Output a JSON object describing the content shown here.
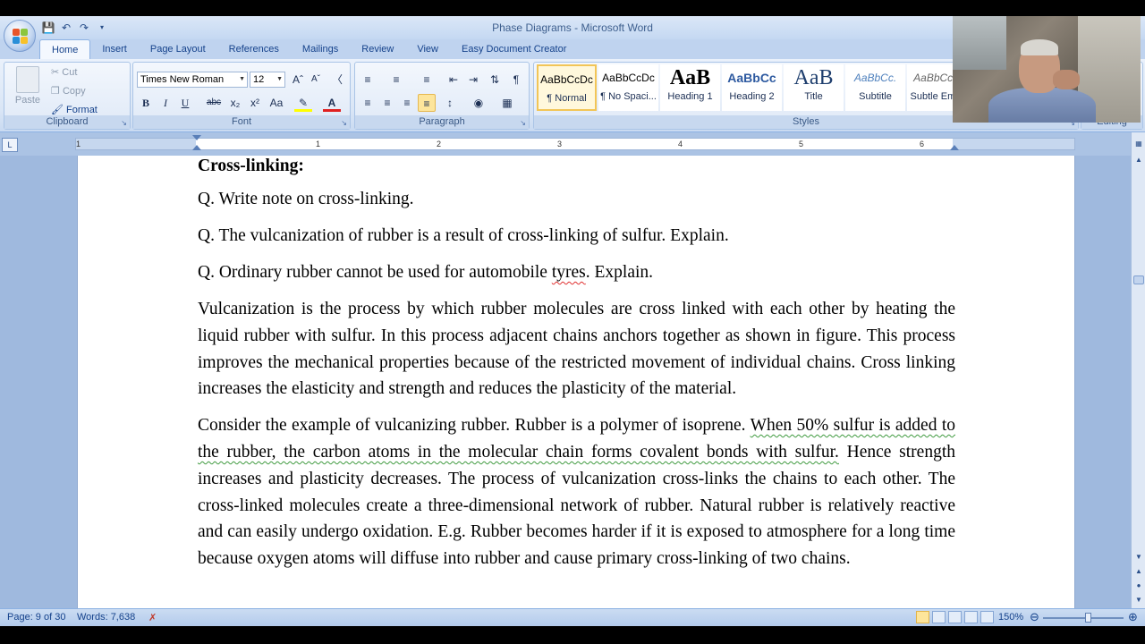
{
  "window": {
    "title": "Phase Diagrams - Microsoft Word"
  },
  "ribbon": {
    "tabs": [
      "Home",
      "Insert",
      "Page Layout",
      "References",
      "Mailings",
      "Review",
      "View",
      "Easy Document Creator"
    ],
    "clipboard": {
      "label": "Clipboard",
      "paste": "Paste",
      "cut": "Cut",
      "copy": "Copy",
      "format_painter": "Format Painter"
    },
    "font": {
      "label": "Font",
      "name": "Times New Roman",
      "size": "12"
    },
    "paragraph": {
      "label": "Paragraph"
    },
    "styles": {
      "label": "Styles",
      "items": [
        {
          "sample": "AaBbCcDc",
          "name": "¶ Normal"
        },
        {
          "sample": "AaBbCcDc",
          "name": "¶ No Spaci..."
        },
        {
          "sample": "AaB",
          "name": "Heading 1"
        },
        {
          "sample": "AaBbCc",
          "name": "Heading 2"
        },
        {
          "sample": "AaB",
          "name": "Title"
        },
        {
          "sample": "AaBbCc.",
          "name": "Subtitle"
        },
        {
          "sample": "AaBbCcD",
          "name": "Subtle Em..."
        }
      ]
    },
    "editing": {
      "label": "Editing"
    }
  },
  "ruler": {
    "numbers": [
      "1",
      "1",
      "2",
      "3",
      "4",
      "5",
      "6"
    ]
  },
  "document": {
    "heading": "Cross-linking:",
    "questions": [
      "Q. Write note on cross-linking.",
      "Q. The vulcanization of rubber is a result of cross-linking of sulfur. Explain."
    ],
    "q3_before": "Q. Ordinary rubber cannot be used for automobile ",
    "q3_flagged": "tyres",
    "q3_after": ". Explain.",
    "para1": "Vulcanization is the process by which rubber molecules are cross linked with each other by heating the liquid rubber with sulfur. In this process adjacent chains anchors together as shown in figure. This process improves the mechanical properties because of the restricted movement of individual chains. Cross linking increases the elasticity and strength and reduces the plasticity of the material.",
    "para2_before": "Consider the example of vulcanizing rubber. Rubber is a polymer of isoprene. ",
    "para2_flagged": "When 50% sulfur is added to the rubber, the carbon atoms in the molecular chain forms covalent bonds with sulfur.",
    "para2_after": " Hence strength increases and plasticity decreases. The process of vulcanization cross-links the chains to each other. The cross-linked molecules create a three-dimensional network of rubber. Natural rubber is relatively reactive and can easily undergo oxidation. E.g. Rubber becomes harder if it is exposed to atmosphere for a long time because oxygen atoms will diffuse into rubber and cause primary cross-linking of two chains."
  },
  "status": {
    "page": "Page: 9 of 30",
    "words": "Words: 7,638",
    "zoom": "150%"
  }
}
